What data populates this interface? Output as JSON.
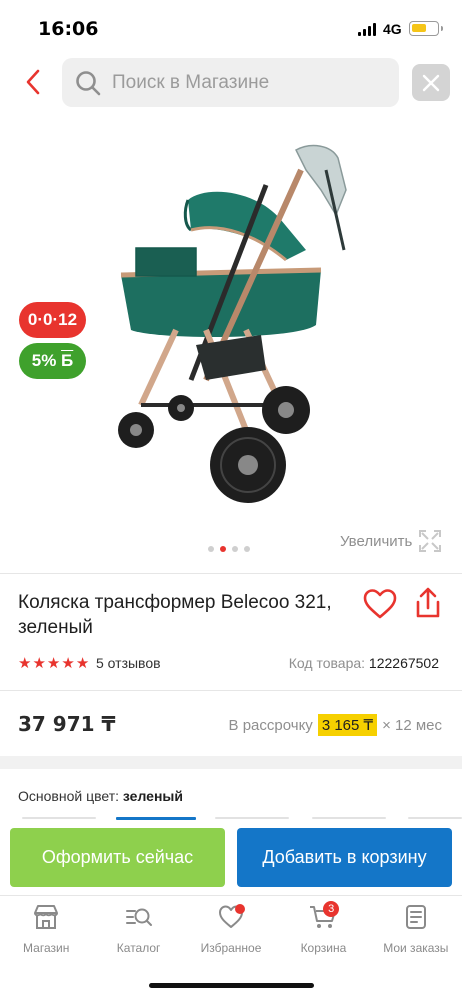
{
  "status_bar": {
    "time": "16:06",
    "network": "4G",
    "battery_level": 0.6,
    "battery_color": "#f5c518"
  },
  "search": {
    "placeholder": "Поиск в Магазине",
    "back_icon": "chevron-left-icon",
    "clear_icon": "close-icon"
  },
  "product": {
    "badges": {
      "installment": "0·0·12",
      "cashback_value": "5%",
      "cashback_currency": "Б"
    },
    "gallery": {
      "image_count": 4,
      "active_index": 1,
      "zoom_label": "Увеличить"
    },
    "title": "Коляска трансформер Belecoo 321, зеленый",
    "rating": 5,
    "reviews": "5 отзывов",
    "sku_label": "Код товара:",
    "sku_value": "122267502",
    "price": "37 971 ₸",
    "installment_label": "В рассрочку",
    "installment_amount": "3 165 ₸",
    "installment_term": "× 12 мес",
    "color_label": "Основной цвет:",
    "color_value": "зеленый"
  },
  "actions": {
    "buy_now": "Оформить сейчас",
    "add_to_cart": "Добавить в корзину"
  },
  "tabs": [
    {
      "label": "Магазин",
      "icon": "shop-icon"
    },
    {
      "label": "Каталог",
      "icon": "catalog-search-icon"
    },
    {
      "label": "Избранное",
      "icon": "heart-icon",
      "dot": true
    },
    {
      "label": "Корзина",
      "icon": "cart-icon",
      "count": "3"
    },
    {
      "label": "Мои заказы",
      "icon": "orders-icon"
    }
  ],
  "colors": {
    "accent_red": "#e8342e",
    "cashback_green": "#3fa12c",
    "buy_green": "#8ed04d",
    "cart_blue": "#1476c8",
    "installment_yellow": "#f6d000"
  }
}
